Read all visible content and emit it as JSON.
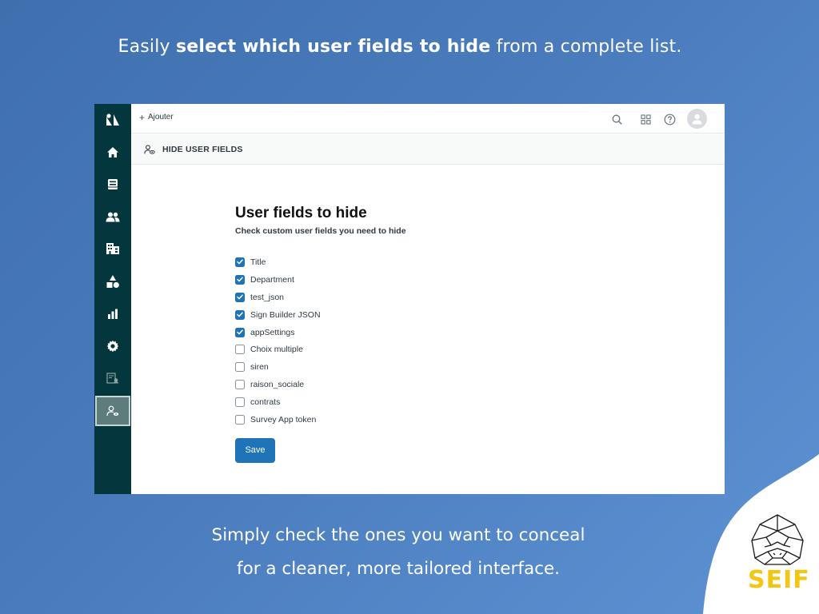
{
  "headline": {
    "prefix": "Easily ",
    "bold": "select which user fields to hide",
    "suffix": " from a complete list."
  },
  "footer": {
    "line1": "Simply check the ones you want to conceal",
    "line2": "for a cleaner, more tailored interface."
  },
  "topbar": {
    "add_label": "Ajouter",
    "icons": [
      "search-icon",
      "apps-grid-icon",
      "help-icon",
      "avatar-icon"
    ]
  },
  "sidebar": {
    "items": [
      "logo-icon",
      "home-icon",
      "inbox-icon",
      "users-icon",
      "organizations-icon",
      "shapes-icon",
      "reporting-icon",
      "settings-icon",
      "app-icon",
      "hide-user-fields-icon"
    ],
    "active_index": 9
  },
  "subheader": {
    "title": "HIDE USER FIELDS"
  },
  "page": {
    "title": "User fields to hide",
    "subtitle": "Check custom user fields you need to hide",
    "save_label": "Save"
  },
  "fields": [
    {
      "label": "Title",
      "checked": true
    },
    {
      "label": "Department",
      "checked": true
    },
    {
      "label": "test_json",
      "checked": true
    },
    {
      "label": "Sign Builder JSON",
      "checked": true
    },
    {
      "label": "appSettings",
      "checked": true
    },
    {
      "label": "Choix multiple",
      "checked": false
    },
    {
      "label": "siren",
      "checked": false
    },
    {
      "label": "raison_sociale",
      "checked": false
    },
    {
      "label": "contrats",
      "checked": false
    },
    {
      "label": "Survey App token",
      "checked": false
    }
  ],
  "brand": {
    "name": "SEIF",
    "color": "#f3c613"
  },
  "colors": {
    "sidebar": "#03363d",
    "primary": "#1f73b7",
    "background": "#4a7cbd"
  }
}
